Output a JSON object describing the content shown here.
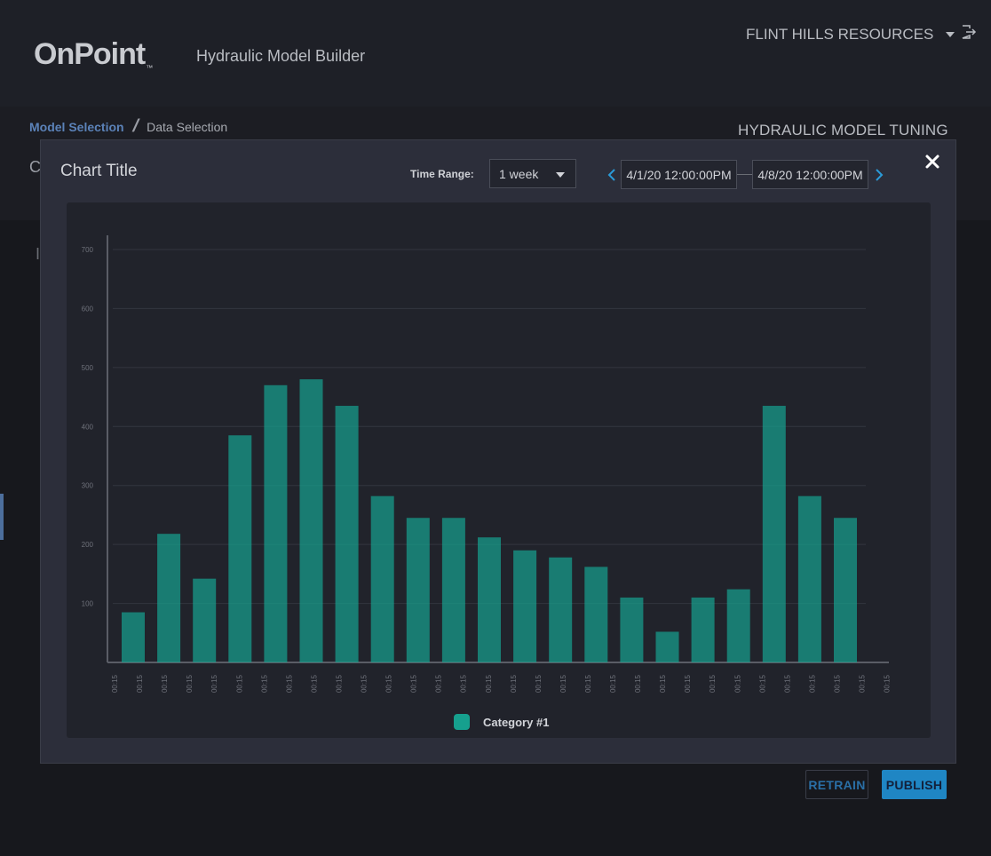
{
  "header": {
    "logo_text": "OnPoint",
    "logo_tm": "™",
    "app_title": "Hydraulic Model Builder",
    "org_name": "FLINT HILLS RESOURCES",
    "icons": {
      "dropdown": "chevron-down-icon",
      "logout": "logout-icon"
    }
  },
  "breadcrumb": {
    "items": [
      "Model Selection",
      "Data Selection"
    ],
    "separator": "/"
  },
  "page": {
    "section_title": "HYDRAULIC MODEL TUNING",
    "partial_letters": [
      "C",
      "I"
    ]
  },
  "modal": {
    "title": "Chart Title",
    "time_range_label": "Time Range:",
    "time_range_value": "1 week",
    "start_date": "4/1/20 12:00:00PM",
    "end_date": "4/8/20 12:00:00PM",
    "icons": {
      "prev": "chevron-left-icon",
      "next": "chevron-right-icon",
      "close": "close-icon"
    }
  },
  "chart_data": {
    "type": "bar",
    "title": "",
    "xlabel": "",
    "ylabel": "",
    "ylim": [
      0,
      700
    ],
    "yticks": [
      100,
      200,
      300,
      400,
      500,
      600,
      700
    ],
    "categories": [
      "00:15",
      "00:15",
      "00:15",
      "00:15",
      "00:15",
      "00:15",
      "00:15",
      "00:15",
      "00:15",
      "00:15",
      "00:15",
      "00:15",
      "00:15",
      "00:15",
      "00:15",
      "00:15",
      "00:15",
      "00:15",
      "00:15",
      "00:15",
      "00:15",
      "00:15",
      "00:15",
      "00:15",
      "00:15",
      "00:15",
      "00:15",
      "00:15",
      "00:15",
      "00:15",
      "00:15",
      "00:15"
    ],
    "series": [
      {
        "name": "Category #1",
        "color": "#16a08e",
        "values": [
          85,
          218,
          142,
          385,
          470,
          480,
          435,
          282,
          245,
          245,
          212,
          190,
          178,
          162,
          110,
          52,
          110,
          124,
          435,
          282,
          245
        ]
      }
    ],
    "grid": true,
    "legend_position": "bottom-center"
  },
  "footer": {
    "retrain_label": "RETRAIN",
    "publish_label": "PUBLISH"
  },
  "colors": {
    "accent": "#1f86c4",
    "bar": "#16a08e",
    "link": "#5b82b8"
  }
}
